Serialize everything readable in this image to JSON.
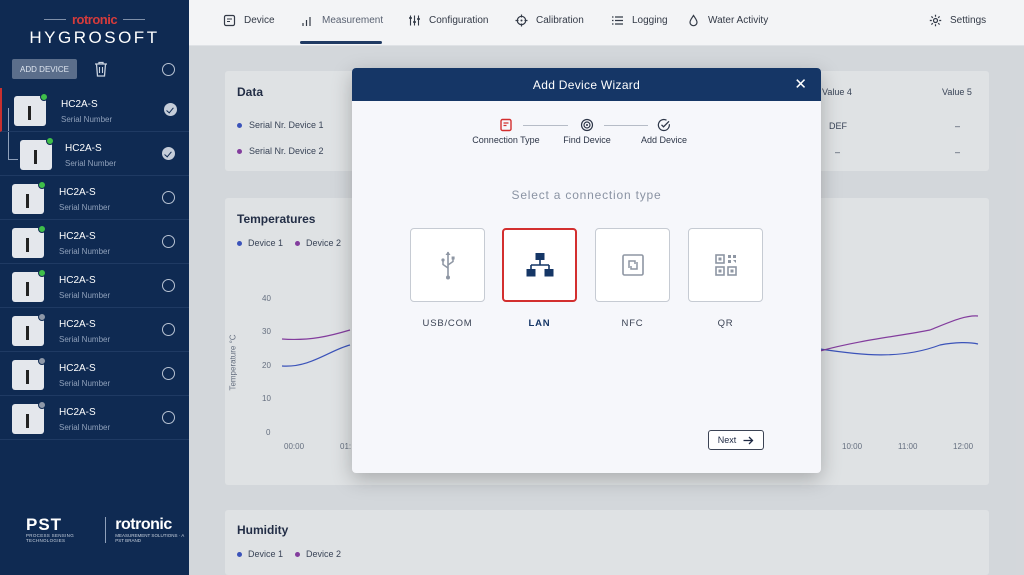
{
  "app": {
    "brand_top": "rotronic",
    "brand_main": "HYGROSOFT"
  },
  "sidebar": {
    "add_device_label": "ADD DEVICE",
    "devices": [
      {
        "name": "HC2A-S",
        "sub": "Serial Number",
        "status": "online",
        "checked": true
      },
      {
        "name": "HC2A-S",
        "sub": "Serial Number",
        "status": "online",
        "checked": true
      },
      {
        "name": "HC2A-S",
        "sub": "Serial Number",
        "status": "online",
        "checked": false
      },
      {
        "name": "HC2A-S",
        "sub": "Serial Number",
        "status": "online",
        "checked": false
      },
      {
        "name": "HC2A-S",
        "sub": "Serial Number",
        "status": "online",
        "checked": false
      },
      {
        "name": "HC2A-S",
        "sub": "Serial Number",
        "status": "offline",
        "checked": false
      },
      {
        "name": "HC2A-S",
        "sub": "Serial Number",
        "status": "offline",
        "checked": false
      },
      {
        "name": "HC2A-S",
        "sub": "Serial Number",
        "status": "offline",
        "checked": false
      }
    ],
    "footer": {
      "pst_big": "PST",
      "pst_small": "PROCESS SENSING TECHNOLOGIES",
      "rot_big": "rotronic",
      "rot_small": "MEASUREMENT SOLUTIONS · A PST BRAND"
    }
  },
  "topnav": {
    "tabs": [
      {
        "label": "Device",
        "icon": "device-icon"
      },
      {
        "label": "Measurement",
        "icon": "measurement-icon"
      },
      {
        "label": "Configuration",
        "icon": "sliders-icon"
      },
      {
        "label": "Calibration",
        "icon": "crosshair-icon"
      },
      {
        "label": "Logging",
        "icon": "list-icon"
      },
      {
        "label": "Water Activity",
        "icon": "drop-icon"
      }
    ],
    "settings_label": "Settings",
    "active_tab": "Measurement"
  },
  "data_card": {
    "title": "Data",
    "rows": [
      "Serial Nr. Device 1",
      "Serial Nr. Device 2"
    ],
    "col_value4": "Value 4",
    "col_value5": "Value 5",
    "r1_v4": "DEF",
    "r1_v5": "–",
    "r2_v4": "–",
    "r2_v5": "–"
  },
  "temp_card": {
    "title": "Temperatures",
    "legend": [
      "Device 1",
      "Device 2"
    ],
    "ylabel": "Temperature °C",
    "yticks": [
      "40",
      "30",
      "20",
      "10",
      "0"
    ],
    "xticks_left": [
      "00:00",
      "01:"
    ],
    "xticks_right": [
      "10:00",
      "11:00",
      "12:00"
    ]
  },
  "hum_card": {
    "title": "Humidity",
    "legend": [
      "Device 1",
      "Device 2"
    ]
  },
  "modal": {
    "title": "Add Device Wizard",
    "close": "✕",
    "steps": [
      "Connection Type",
      "Find Device",
      "Add Device"
    ],
    "active_step": 0,
    "prompt": "Select a connection type",
    "options": [
      {
        "label": "USB/COM",
        "icon": "usb-icon"
      },
      {
        "label": "LAN",
        "icon": "lan-icon"
      },
      {
        "label": "NFC",
        "icon": "nfc-icon"
      },
      {
        "label": "QR",
        "icon": "qr-icon"
      }
    ],
    "selected_option": "LAN",
    "next_label": "Next"
  },
  "colors": {
    "sidebar_bg": "#0f2a52",
    "modal_header": "#153666",
    "accent_red": "#d32f2f",
    "online": "#3fbf4a",
    "series1": "#3c55c8",
    "series2": "#8e3ca8"
  }
}
